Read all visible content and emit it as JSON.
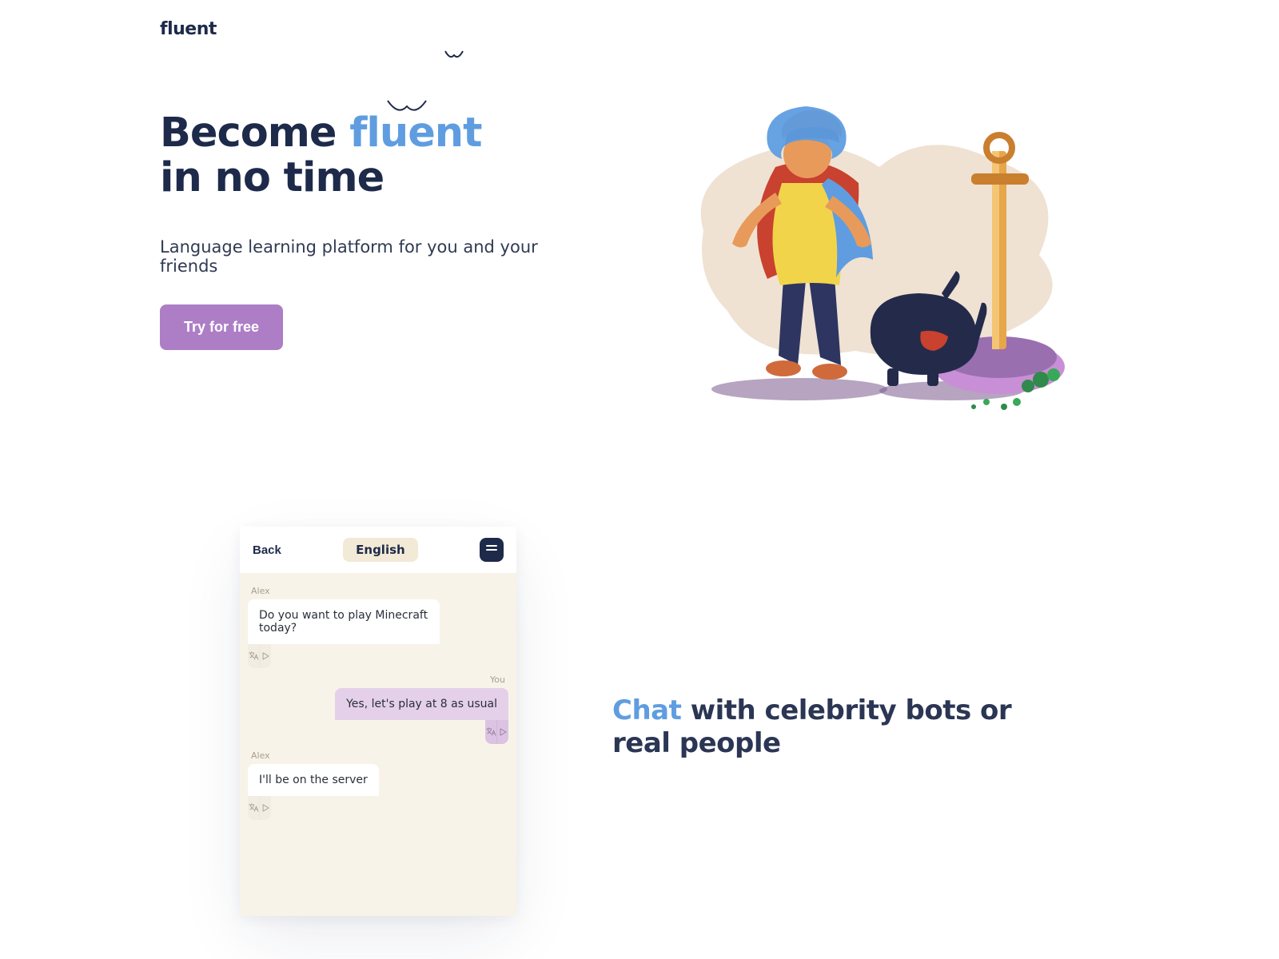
{
  "brand": "fluent",
  "hero": {
    "title_prefix": "Become ",
    "title_accent": "fluent",
    "title_line2": "in no time",
    "subtitle": "Language learning platform for you and your friends",
    "cta": "Try for free"
  },
  "chat_panel": {
    "back": "Back",
    "language": "English",
    "messages": [
      {
        "sender": "Alex",
        "side": "left",
        "text": "Do you want to play Minecraft today?"
      },
      {
        "sender": "You",
        "side": "right",
        "text": "Yes, let's play at 8 as usual"
      },
      {
        "sender": "Alex",
        "side": "left",
        "text": "I'll be on the server"
      }
    ]
  },
  "section2": {
    "title_accent": "Chat",
    "title_rest": " with celebrity bots or real people"
  },
  "colors": {
    "brand_dark": "#1e2a4a",
    "accent_blue": "#5f9de0",
    "cta_purple": "#ad7ec6",
    "chat_bg": "#f8f3e8",
    "chip_bg": "#f2e9d6",
    "you_bubble": "#e5d0e9"
  }
}
